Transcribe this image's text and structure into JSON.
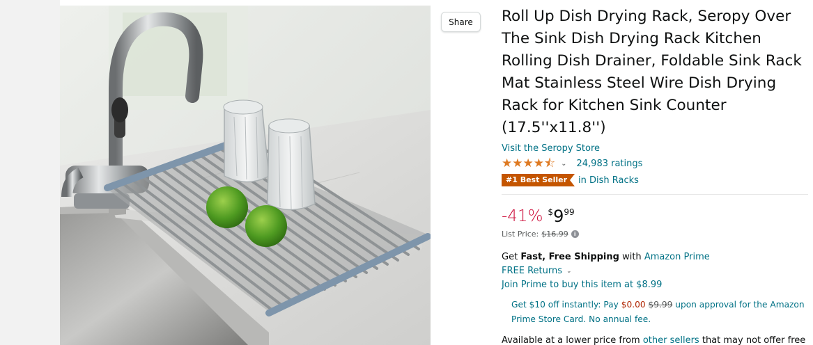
{
  "share": {
    "label": "Share"
  },
  "product": {
    "title": "Roll Up Dish Drying Rack, Seropy Over The Sink Dish Drying Rack Kitchen Rolling Dish Drainer, Foldable Sink Rack Mat Stainless Steel Wire Dish Drying Rack for Kitchen Sink Counter (17.5''x11.8'')",
    "store_link": "Visit the Seropy Store",
    "rating": {
      "stars": 4.5,
      "count_label": "24,983 ratings"
    },
    "bestseller": {
      "badge": "#1 Best Seller",
      "category": "in Dish Racks"
    }
  },
  "pricing": {
    "discount": "-41%",
    "currency_symbol": "$",
    "whole": "9",
    "fraction": "99",
    "list_price_label": "List Price:",
    "list_price_value": "$16.99"
  },
  "shipping": {
    "get": "Get",
    "fast_free": "Fast, Free Shipping",
    "with": "with",
    "prime_link": "Amazon Prime",
    "returns": "FREE Returns",
    "join_prime": "Join Prime to buy this item at $8.99"
  },
  "card_offer": {
    "part1": "Get $10 off instantly: Pay",
    "pay_price": "$0.00",
    "old_price": "$9.99",
    "part2": "upon approval for the Amazon Prime Store Card. No annual fee."
  },
  "lower_price": {
    "part1": "Available at a lower price from",
    "link": "other sellers",
    "part2": "that may not offer free"
  },
  "colors": {
    "link": "#007185",
    "star": "#de7921",
    "discount": "#cc0c39",
    "bestseller": "#c45500"
  }
}
